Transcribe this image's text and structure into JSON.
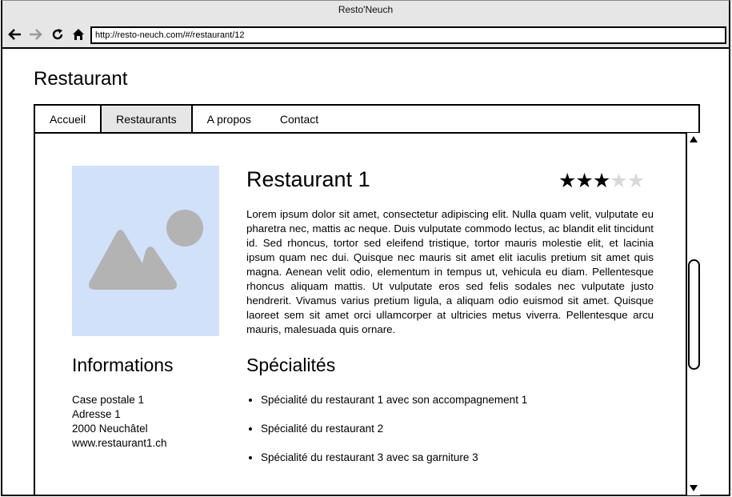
{
  "browser": {
    "title": "Resto'Neuch",
    "url": "http://resto-neuch.com/#/restaurant/12"
  },
  "page": {
    "title": "Restaurant"
  },
  "nav": {
    "tabs": [
      {
        "label": "Accueil",
        "active": false
      },
      {
        "label": "Restaurants",
        "active": true
      },
      {
        "label": "A propos",
        "active": false
      },
      {
        "label": "Contact",
        "active": false
      }
    ]
  },
  "restaurant": {
    "name": "Restaurant 1",
    "rating": 3,
    "rating_max": 5,
    "description": "Lorem ipsum dolor sit amet, consectetur adipiscing elit. Nulla quam velit, vulputate eu pharetra nec, mattis ac neque. Duis vulputate commodo lectus, ac blandit elit tincidunt id. Sed rhoncus, tortor sed eleifend tristique, tortor mauris molestie elit, et lacinia ipsum quam nec dui. Quisque nec mauris sit amet elit iaculis pretium sit amet quis magna. Aenean velit odio, elementum in tempus ut, vehicula eu diam. Pellentesque rhoncus aliquam mattis. Ut vulputate eros sed felis sodales nec vulputate justo hendrerit. Vivamus varius pretium ligula, a aliquam odio euismod sit amet. Quisque laoreet sem sit amet orci ullamcorper at ultricies metus viverra. Pellentesque arcu mauris, malesuada quis ornare."
  },
  "informations": {
    "title": "Informations",
    "lines": [
      "Case postale 1",
      "Adresse 1",
      "2000 Neuchâtel",
      "www.restaurant1.ch"
    ]
  },
  "specialites": {
    "title": "Spécialités",
    "items": [
      "Spécialité du restaurant 1 avec son accompagnement 1",
      "Spécialité du restaurant 2",
      "Spécialité du restaurant 3 avec sa garniture 3"
    ]
  },
  "colors": {
    "image_placeholder_bg": "#d0e1f9",
    "image_placeholder_fg": "#b3b3b3",
    "chrome_bg": "#e6e6e6",
    "star_on": "#000000",
    "star_off": "#d8d8d8"
  },
  "icons": {
    "back": "arrow-left-icon",
    "forward": "arrow-right-icon",
    "reload": "reload-icon",
    "home": "home-icon",
    "image": "image-placeholder-icon"
  }
}
